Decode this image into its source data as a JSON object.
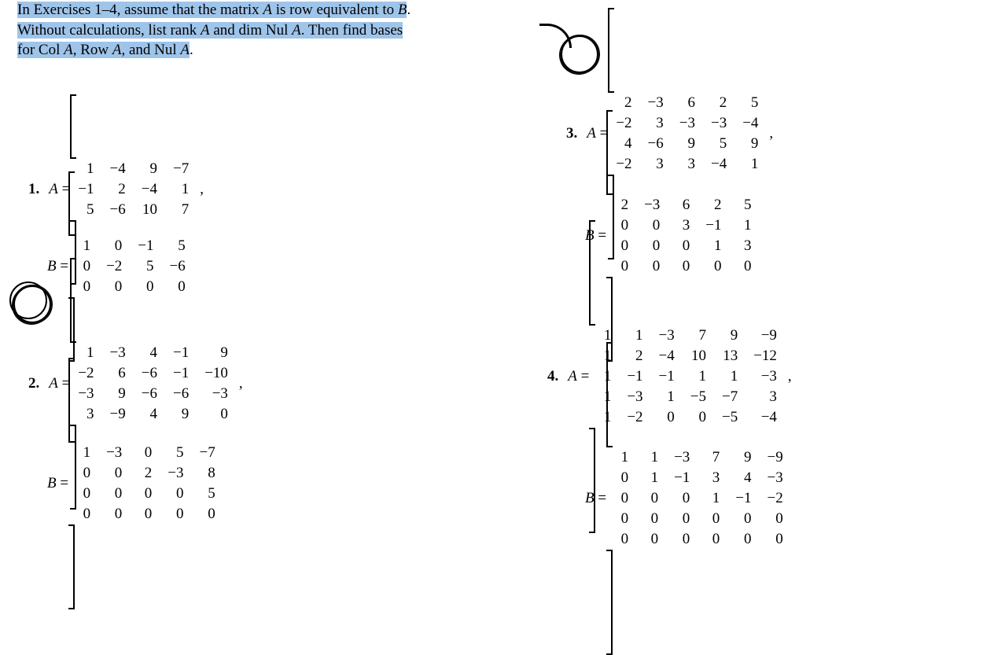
{
  "instructions": {
    "line1_a": "In Exercises 1–4, assume that the matrix ",
    "line1_A": "A",
    "line1_b": " is row equivalent to ",
    "line1_B": "B",
    "line1_c": ".",
    "line2_a": "Without calculations, list rank ",
    "line2_A": "A",
    "line2_b": " and dim Nul ",
    "line2_A2": "A",
    "line2_c": ". Then find bases",
    "line3_a": "for Col ",
    "line3_A": "A",
    "line3_b": ", Row ",
    "line3_A2": "A",
    "line3_c": ", and Nul ",
    "line3_A3": "A",
    "line3_d": "."
  },
  "labels": {
    "p1": "1.",
    "p2": "2.",
    "p3": "3.",
    "p4": "4."
  },
  "sym": {
    "A": "A",
    "B": "B",
    "eq": " = ",
    "comma": ","
  },
  "chart_data": [
    {
      "type": "table",
      "name": "A1",
      "values": [
        [
          1,
          -4,
          9,
          -7
        ],
        [
          -1,
          2,
          -4,
          1
        ],
        [
          5,
          -6,
          10,
          7
        ]
      ]
    },
    {
      "type": "table",
      "name": "B1",
      "values": [
        [
          1,
          0,
          -1,
          5
        ],
        [
          0,
          -2,
          5,
          -6
        ],
        [
          0,
          0,
          0,
          0
        ]
      ]
    },
    {
      "type": "table",
      "name": "A2",
      "values": [
        [
          1,
          -3,
          4,
          -1,
          9
        ],
        [
          -2,
          6,
          -6,
          -1,
          -10
        ],
        [
          -3,
          9,
          -6,
          -6,
          -3
        ],
        [
          3,
          -9,
          4,
          9,
          0
        ]
      ]
    },
    {
      "type": "table",
      "name": "B2",
      "values": [
        [
          1,
          -3,
          0,
          5,
          -7
        ],
        [
          0,
          0,
          2,
          -3,
          8
        ],
        [
          0,
          0,
          0,
          0,
          5
        ],
        [
          0,
          0,
          0,
          0,
          0
        ]
      ]
    },
    {
      "type": "table",
      "name": "A3",
      "values": [
        [
          2,
          -3,
          6,
          2,
          5
        ],
        [
          -2,
          3,
          -3,
          -3,
          -4
        ],
        [
          4,
          -6,
          9,
          5,
          9
        ],
        [
          -2,
          3,
          3,
          -4,
          1
        ]
      ]
    },
    {
      "type": "table",
      "name": "B3",
      "values": [
        [
          2,
          -3,
          6,
          2,
          5
        ],
        [
          0,
          0,
          3,
          -1,
          1
        ],
        [
          0,
          0,
          0,
          1,
          3
        ],
        [
          0,
          0,
          0,
          0,
          0
        ]
      ]
    },
    {
      "type": "table",
      "name": "A4",
      "values": [
        [
          1,
          1,
          -3,
          7,
          9,
          -9
        ],
        [
          1,
          2,
          -4,
          10,
          13,
          -12
        ],
        [
          1,
          -1,
          -1,
          1,
          1,
          -3
        ],
        [
          1,
          -3,
          1,
          -5,
          -7,
          3
        ],
        [
          1,
          -2,
          0,
          0,
          -5,
          -4
        ]
      ]
    },
    {
      "type": "table",
      "name": "B4",
      "values": [
        [
          1,
          1,
          -3,
          7,
          9,
          -9
        ],
        [
          0,
          1,
          -1,
          3,
          4,
          -3
        ],
        [
          0,
          0,
          0,
          1,
          -1,
          -2
        ],
        [
          0,
          0,
          0,
          0,
          0,
          0
        ],
        [
          0,
          0,
          0,
          0,
          0,
          0
        ]
      ]
    }
  ]
}
